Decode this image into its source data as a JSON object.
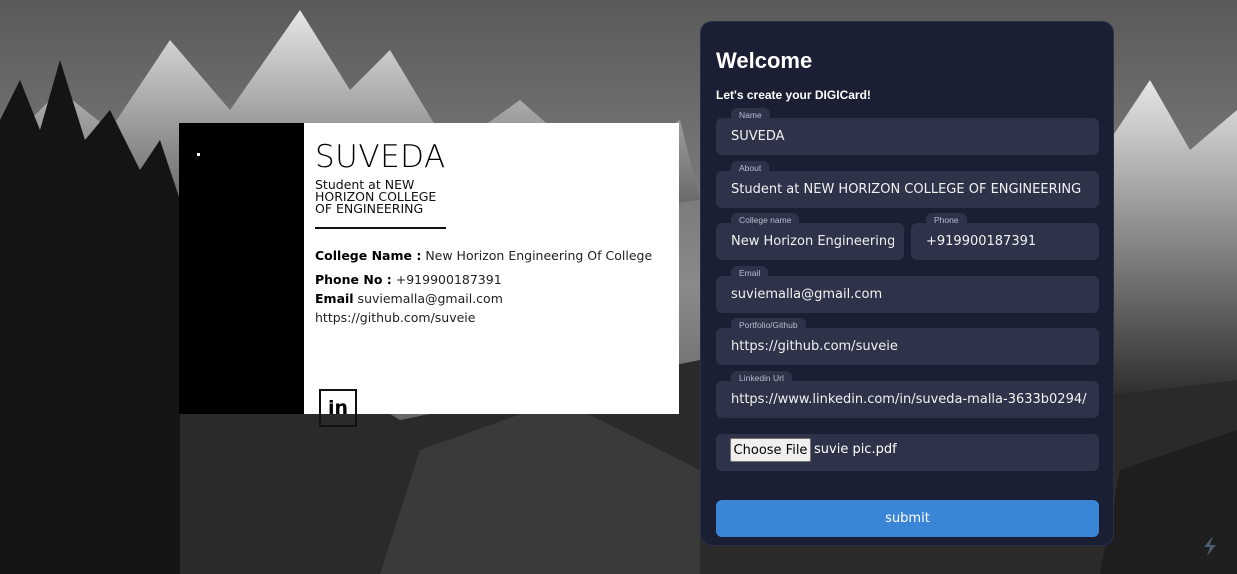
{
  "card": {
    "name": "SUVEDA",
    "about_line1": "Student at NEW",
    "about_line2": "HORIZON COLLEGE",
    "about_line3": "OF ENGINEERING",
    "college_label": "College Name :",
    "college_value": " New Horizon Engineering Of College",
    "phone_label": "Phone No :",
    "phone_value": " +919900187391",
    "email_label": "Email",
    "email_value": " suviemalla@gmail.com",
    "github": "https://github.com/suveie",
    "linkedin_icon": "linkedin-icon",
    "linkedin_text": "in"
  },
  "form": {
    "title": "Welcome",
    "subtitle": "Let's create your DIGICard!",
    "fields": [
      {
        "label": "Name",
        "value": "SUVEDA"
      },
      {
        "label": "About",
        "value": "Student at NEW HORIZON COLLEGE OF ENGINEERING"
      },
      {
        "label": "College name",
        "value": "New Horizon Engineering Of College"
      },
      {
        "label": "Phone",
        "value": "+919900187391"
      },
      {
        "label": "Email",
        "value": "suviemalla@gmail.com"
      },
      {
        "label": "Portfolio/Github",
        "value": "https://github.com/suveie"
      },
      {
        "label": "Linkedin Url",
        "value": "https://www.linkedin.com/in/suveda-malla-3633b0294/"
      }
    ],
    "file_button": "Choose File",
    "file_name": "suvie pic.pdf",
    "submit_label": "submit"
  },
  "colors": {
    "panel": "#1b1f33",
    "field": "#2e3349",
    "accent": "#3a85d6"
  }
}
